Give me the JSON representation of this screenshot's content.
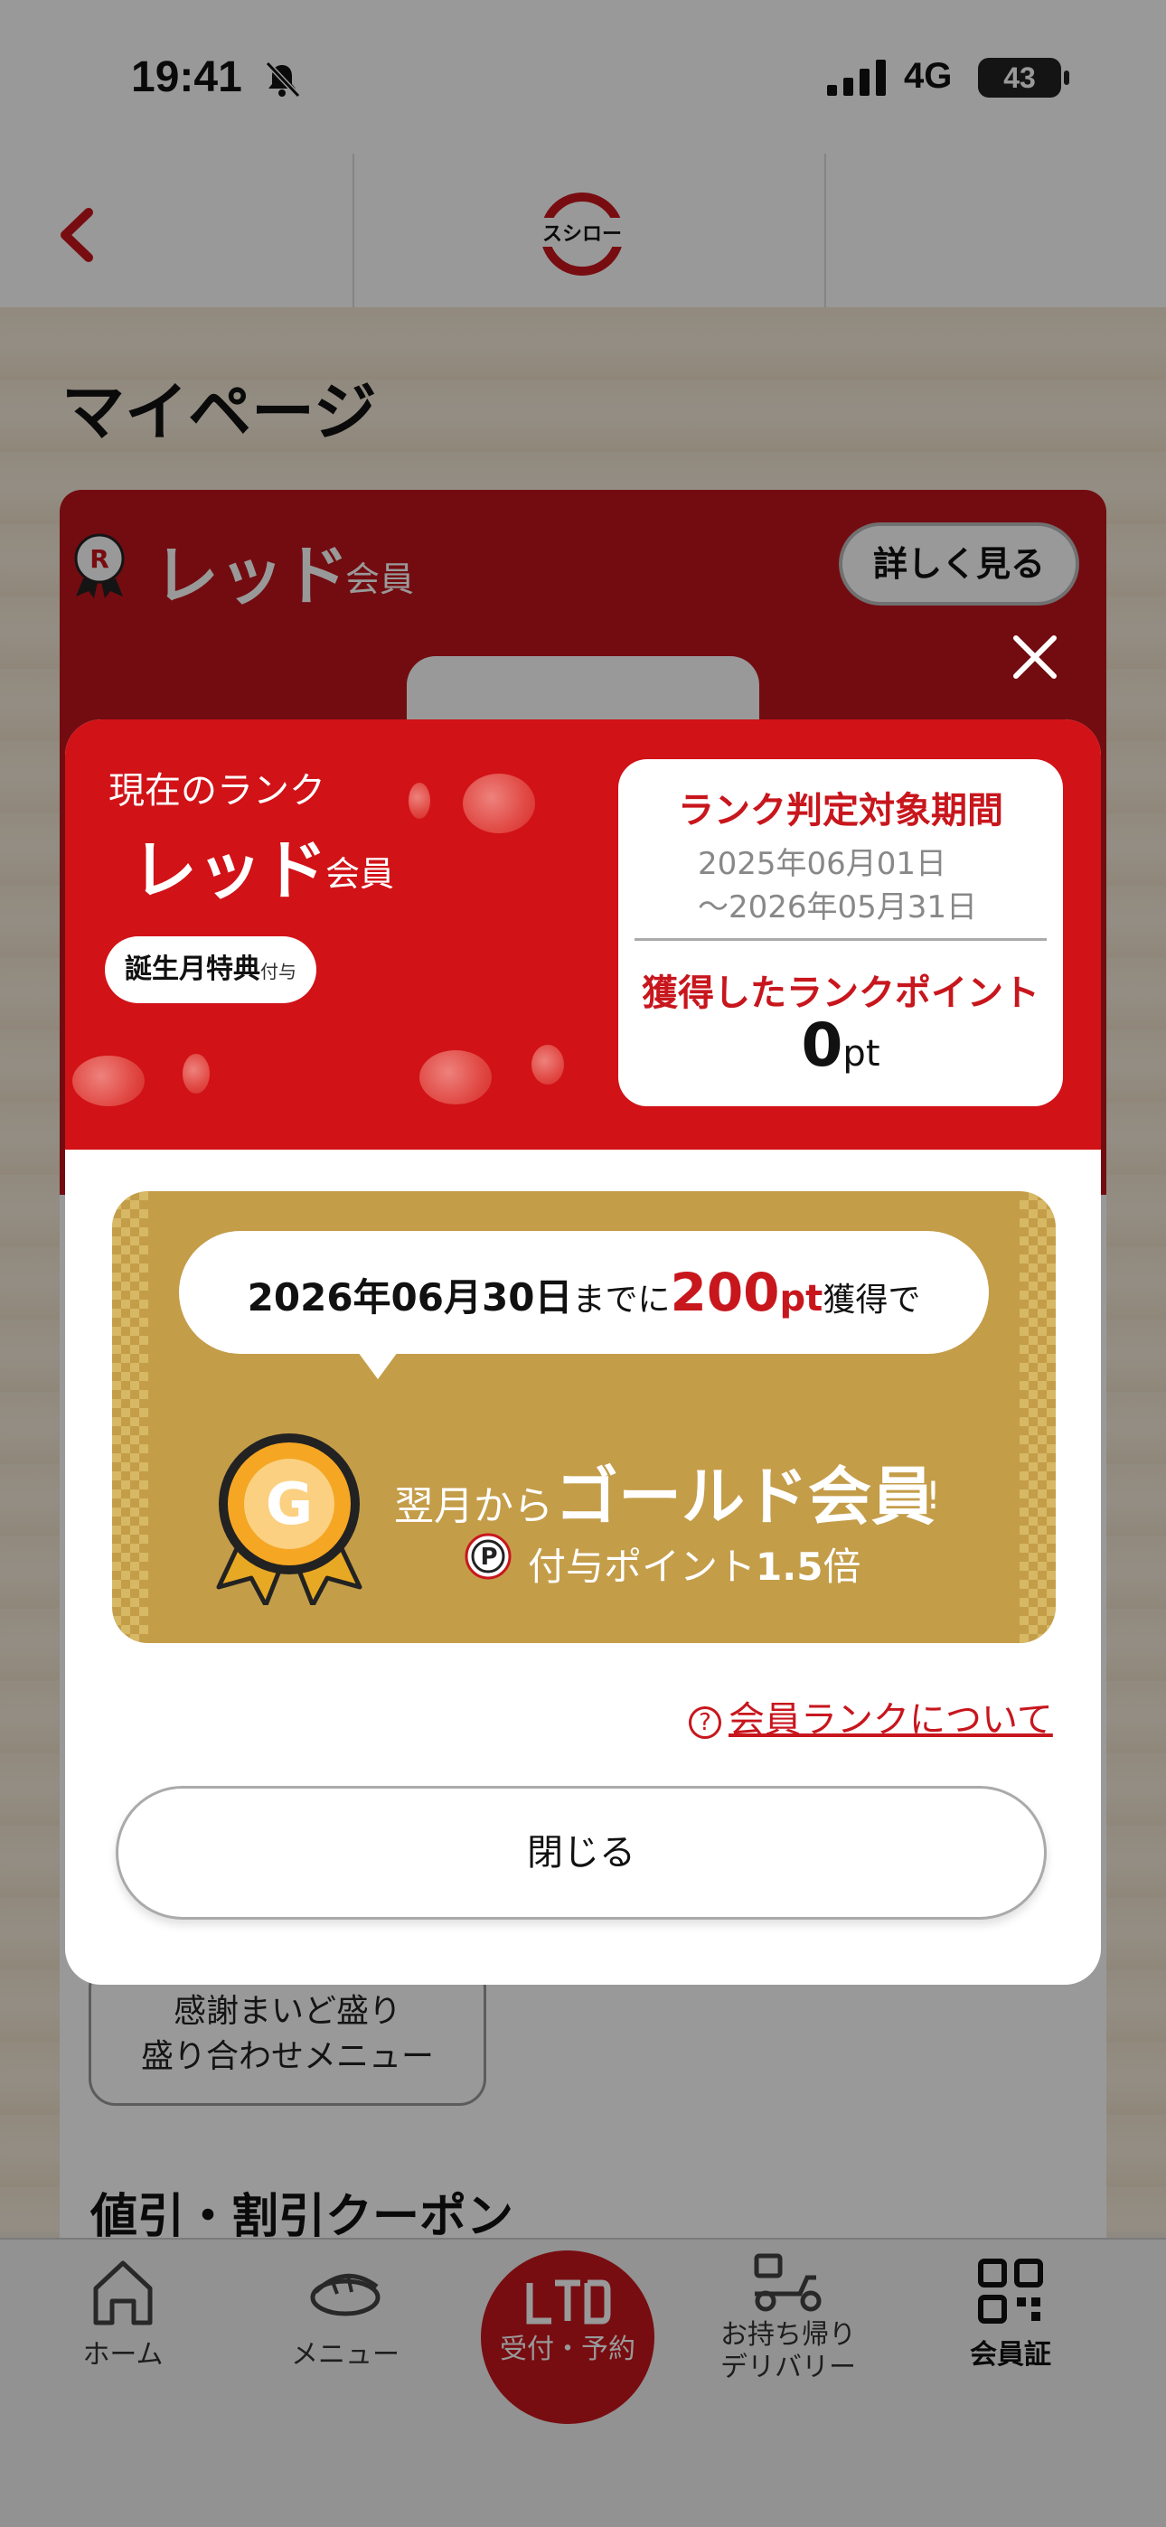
{
  "status_bar": {
    "time": "19:41",
    "network": "4G",
    "battery": "43"
  },
  "nav": {
    "brand": "スシロー"
  },
  "page": {
    "title": "マイページ"
  },
  "member_card": {
    "rank_name": "レッド",
    "rank_suffix": "会員",
    "details_label": "詳しく見る"
  },
  "background": {
    "coupon_button_line1": "感謝まいど盛り",
    "coupon_button_line2": "盛り合わせメニュー",
    "coupon_section_title": "値引・割引クーポン"
  },
  "modal": {
    "current_rank_label": "現在のランク",
    "rank_name": "レッド",
    "rank_suffix": "会員",
    "birthday_badge": "誕生月特典",
    "birthday_badge_sub": "付与",
    "period_title": "ランク判定対象期間",
    "period_start": "2025年06月01日",
    "period_end": "〜2026年05月31日",
    "points_title": "獲得したランクポイント",
    "points_value": "0",
    "points_unit": "pt",
    "goal_date": "2026年06月30日",
    "goal_mid": "までに",
    "goal_points": "200",
    "goal_pt": "pt",
    "goal_end": "獲得で",
    "next_month": "翌月から",
    "gold_member": "ゴールド会員",
    "exclaim": "!",
    "bonus_text": "付与ポイント",
    "bonus_multiplier": "1.5",
    "bonus_suffix": "倍",
    "help_link": "会員ランクについて",
    "help_mark": "?",
    "close_label": "閉じる"
  },
  "tabs": [
    {
      "label": "ホーム",
      "icon": "home-icon"
    },
    {
      "label": "メニュー",
      "icon": "sushi-icon"
    },
    {
      "label": "受付・予約",
      "icon": "reserve-icon"
    },
    {
      "label_line1": "お持ち帰り",
      "label_line2": "デリバリー",
      "icon": "delivery-icon"
    },
    {
      "label": "会員証",
      "icon": "qr-code-icon"
    }
  ],
  "colors": {
    "brand_red": "#d11217",
    "gold": "#c49d49"
  }
}
